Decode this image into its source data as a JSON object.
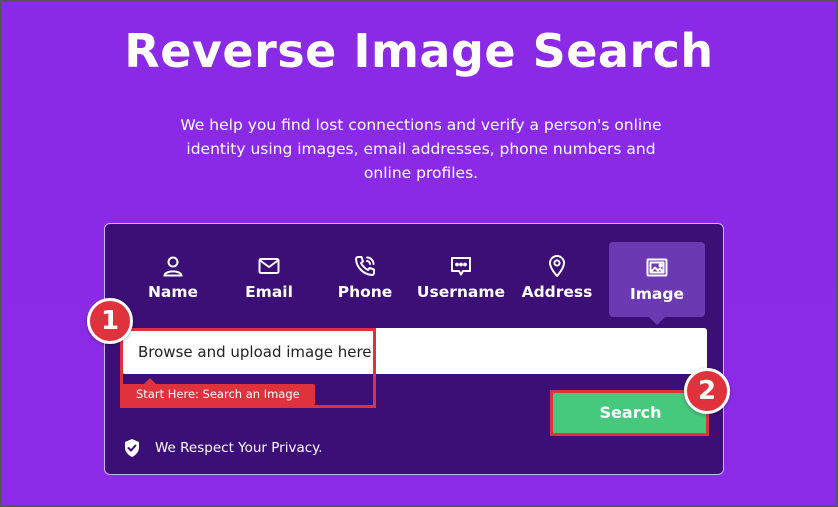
{
  "hero": {
    "title": "Reverse Image Search",
    "subtitle": "We help you find lost connections and verify a person's online identity using images, email addresses, phone numbers and online profiles."
  },
  "tabs": [
    {
      "label": "Name",
      "icon": "person-icon"
    },
    {
      "label": "Email",
      "icon": "envelope-icon"
    },
    {
      "label": "Phone",
      "icon": "phone-icon"
    },
    {
      "label": "Username",
      "icon": "chat-icon"
    },
    {
      "label": "Address",
      "icon": "location-pin-icon"
    },
    {
      "label": "Image",
      "icon": "image-icon",
      "active": true
    }
  ],
  "search": {
    "placeholder": "Browse and upload image here",
    "hint": "Start Here: Search an Image",
    "button_label": "Search"
  },
  "privacy": {
    "text": "We Respect Your Privacy."
  },
  "annotations": {
    "badge_1": "1",
    "badge_2": "2"
  },
  "colors": {
    "background": "#8a2be6",
    "panel": "#3b0f75",
    "active_tab": "#6b3ab3",
    "search_button": "#46c87d",
    "highlight": "#e0323c"
  }
}
